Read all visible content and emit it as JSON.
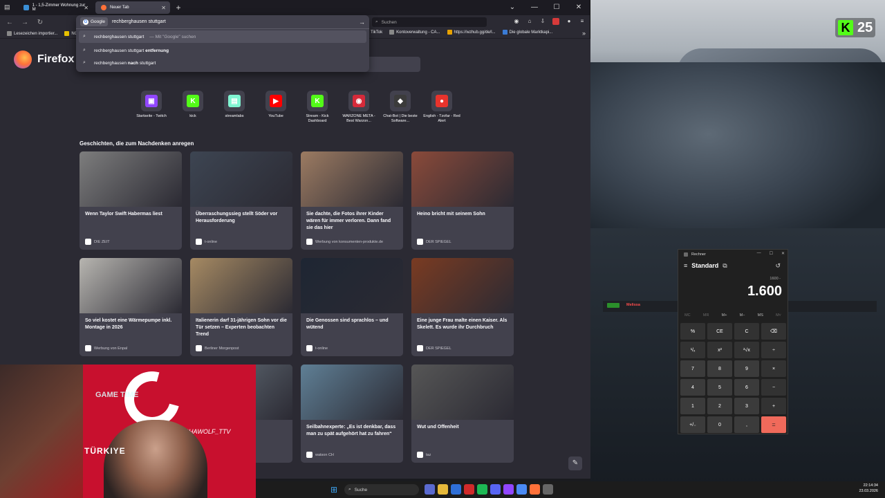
{
  "browser": {
    "tabs": [
      {
        "label": "1 - 1,5-Zimmer Wohnung zur M",
        "active": false
      },
      {
        "label": "Neuer Tab",
        "active": true
      }
    ],
    "urlbar": {
      "engine": "Google",
      "value": "rechberghausen stuttgart",
      "suggestions": [
        {
          "text": "rechberghausen stuttgart",
          "hint": "— Mit \"Google\" suchen"
        },
        {
          "text": "rechberghausen stuttgart",
          "bold": "entfernung"
        },
        {
          "text": "rechberghausen",
          "bold": "nach",
          "rest": "stuttgart"
        }
      ]
    },
    "search_placeholder": "Suchen",
    "bookmarks_left": [
      "Lesezeichen importier...",
      "NO"
    ],
    "bookmarks_right": [
      "TikTok",
      "Kontoverwaltung - CA...",
      "https://wzhub.gg/de/l...",
      "Die globale Marktkapi..."
    ]
  },
  "newtab": {
    "brand": "Firefox",
    "topsites": [
      {
        "label": "Startseite - Twitch",
        "color": "#9146ff",
        "glyph": "▣"
      },
      {
        "label": "kick",
        "color": "#53fc18",
        "glyph": "K"
      },
      {
        "label": "streamlabs",
        "color": "#80f5d2",
        "glyph": "▤"
      },
      {
        "label": "YouTube",
        "color": "#ff0000",
        "glyph": "▶"
      },
      {
        "label": "Stream - Kick Dashboard",
        "color": "#53fc18",
        "glyph": "K"
      },
      {
        "label": "WARZONE META - Best Warzon...",
        "color": "#d62a3a",
        "glyph": "◉"
      },
      {
        "label": "Chat-Bot | Die beste Software...",
        "color": "#3b3b3b",
        "glyph": "◆"
      },
      {
        "label": "English - Tzofar - Red Alert",
        "color": "#e8332c",
        "glyph": "●"
      }
    ],
    "stories_title": "Geschichten, die zum Nachdenken anregen",
    "stories": [
      {
        "title": "Wenn Taylor Swift Habermas liest",
        "source": "DIE ZEIT",
        "img": "#7d7d7d",
        "icon": "Z"
      },
      {
        "title": "Überraschungssieg stellt Söder vor Herausforderung",
        "source": "t-online",
        "img": "#3d4552",
        "icon": "—"
      },
      {
        "title": "Sie dachte, die Fotos ihrer Kinder wären für immer verloren. Dann fand sie das hier",
        "source": "Werbung von konsumenten-produkte.de",
        "img": "#9c7b62",
        "icon": ""
      },
      {
        "title": "Heino bricht mit seinem Sohn",
        "source": "DER SPIEGEL",
        "img": "#8a4a3a",
        "icon": "S"
      },
      {
        "title": "So viel kostet eine Wärmepumpe inkl. Montage in 2026",
        "source": "Werbung von Enpal",
        "img": "#b7b5b0",
        "icon": ""
      },
      {
        "title": "Italienerin darf 31-jährigen Sohn vor die Tür setzen – Experten beobachten Trend",
        "source": "Berliner Morgenpost",
        "img": "#a68a63",
        "icon": "M"
      },
      {
        "title": "Die Genossen sind sprachlos – und wütend",
        "source": "t-online",
        "img": "#1e2633",
        "icon": "—"
      },
      {
        "title": "Eine junge Frau malte einen Kaiser. Als Skelett. Es wurde ihr Durchbruch",
        "source": "DER SPIEGEL",
        "img": "#7a3b22",
        "icon": "S"
      },
      {
        "title": "",
        "source": "",
        "img": "#6d6a66",
        "icon": ""
      },
      {
        "title": "…gt der …s Gesicht“",
        "source": "",
        "img": "#6a7680",
        "icon": ""
      },
      {
        "title": "Seilbahnexperte: „Es ist denkbar, dass man zu spät aufgehört hat zu fahren“",
        "source": "watson CH",
        "img": "#5f7f95",
        "icon": "W"
      },
      {
        "title": "Wut und Offenheit",
        "source": "taz",
        "img": "#565656",
        "icon": "T"
      }
    ]
  },
  "webcam": {
    "overlay_text": "GAME TIME",
    "handle": "ALPHAWOLF_TTV",
    "shirt": "TÜRKIYE"
  },
  "kick_badge": "25",
  "overlay_label": "Melissa",
  "calculator": {
    "title": "Rechner",
    "mode": "Standard",
    "expression": "1600 -",
    "display": "1.600",
    "memory": [
      "MC",
      "MR",
      "M+",
      "M−",
      "MS",
      "M˅"
    ],
    "keys": [
      "%",
      "CE",
      "C",
      "⌫",
      "¹/ₓ",
      "x²",
      "²√x",
      "÷",
      "7",
      "8",
      "9",
      "×",
      "4",
      "5",
      "6",
      "−",
      "1",
      "2",
      "3",
      "+",
      "+/₋",
      "0",
      ",",
      "="
    ]
  },
  "taskbar": {
    "search_label": "Suche",
    "time": "22:14:34",
    "date": "23.03.2026"
  }
}
